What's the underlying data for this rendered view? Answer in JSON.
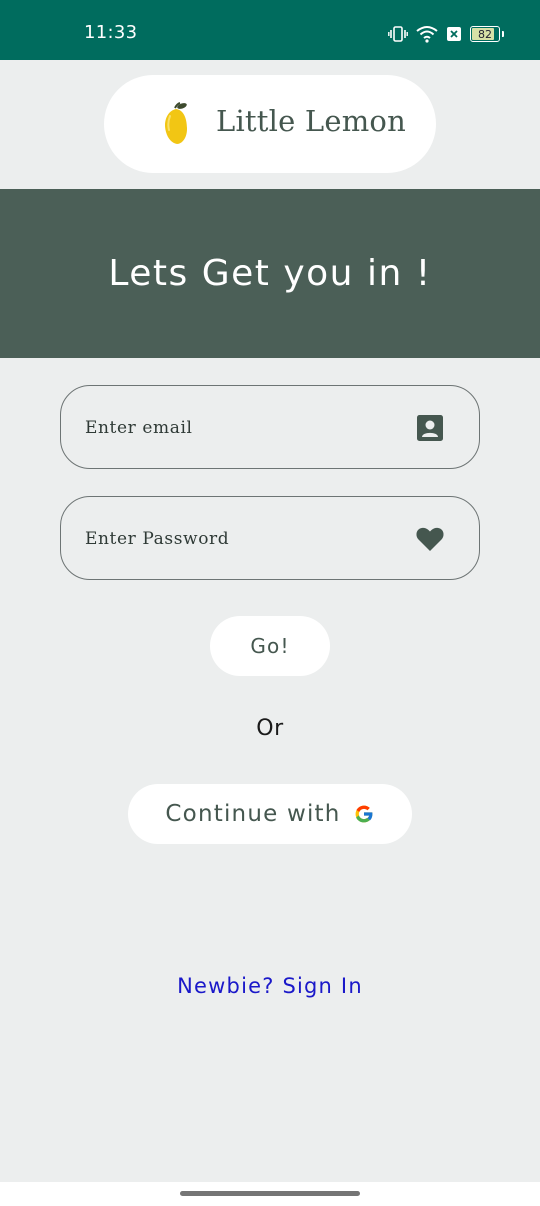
{
  "status_bar": {
    "time": "11:33",
    "battery_level": "82",
    "icons": [
      "vibrate-icon",
      "wifi-icon",
      "sim-off-icon",
      "battery-icon"
    ],
    "color": "#006C5E"
  },
  "header": {
    "logo_text": "Little Lemon",
    "logo_icon": "lemon-icon"
  },
  "banner": {
    "title": "Lets Get you in !",
    "color": "#4B5F57"
  },
  "form": {
    "email": {
      "placeholder": "Enter email",
      "value": "",
      "icon": "contact-card-icon"
    },
    "password": {
      "placeholder": "Enter Password",
      "value": "",
      "icon": "heart-icon"
    },
    "submit_label": "Go!"
  },
  "divider_text": "Or",
  "google_button": {
    "label": "Continue with",
    "icon": "google-icon"
  },
  "signup_link": "Newbie? Sign In",
  "colors": {
    "accent": "#45574F",
    "link": "#1A18C9",
    "background": "#ECEEEE"
  }
}
